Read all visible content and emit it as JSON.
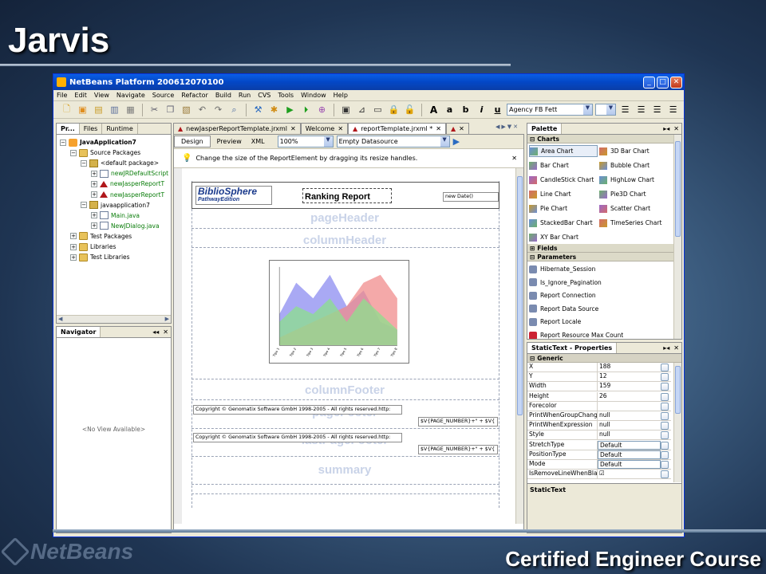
{
  "slide": {
    "title": "Jarvis",
    "footer": "Certified Engineer Course",
    "logo_text": "NetBeans"
  },
  "window": {
    "title": "NetBeans Platform 200612070100",
    "controls": [
      "_",
      "□",
      "✕"
    ]
  },
  "menu": [
    "File",
    "Edit",
    "View",
    "Navigate",
    "Source",
    "Refactor",
    "Build",
    "Run",
    "CVS",
    "Tools",
    "Window",
    "Help"
  ],
  "toolbar": {
    "font_name": "Agency FB Fett",
    "format_buttons": [
      "A",
      "a",
      "b",
      "i",
      "u"
    ]
  },
  "left_panel": {
    "tabs": [
      "Pr...",
      "Files",
      "Runtime"
    ],
    "tree": [
      {
        "label": "JavaApplication7",
        "depth": 0,
        "icon": "proj",
        "color": "black",
        "bold": true
      },
      {
        "label": "Source Packages",
        "depth": 1,
        "icon": "folder",
        "color": "black"
      },
      {
        "label": "<default package>",
        "depth": 2,
        "icon": "pkg",
        "color": "black"
      },
      {
        "label": "newJRDefaultScript",
        "depth": 3,
        "icon": "java",
        "color": "green"
      },
      {
        "label": "newJasperReportT",
        "depth": 3,
        "icon": "jr",
        "color": "green"
      },
      {
        "label": "newJasperReportT",
        "depth": 3,
        "icon": "jr",
        "color": "green"
      },
      {
        "label": "javaapplication7",
        "depth": 2,
        "icon": "pkg",
        "color": "black"
      },
      {
        "label": "Main.java",
        "depth": 3,
        "icon": "java",
        "color": "green"
      },
      {
        "label": "NewJDialog.java",
        "depth": 3,
        "icon": "java",
        "color": "green"
      },
      {
        "label": "Test Packages",
        "depth": 1,
        "icon": "folder",
        "color": "black"
      },
      {
        "label": "Libraries",
        "depth": 1,
        "icon": "folder",
        "color": "black"
      },
      {
        "label": "Test Libraries",
        "depth": 1,
        "icon": "folder",
        "color": "black"
      }
    ]
  },
  "navigator": {
    "title": "Navigator",
    "empty_text": "<No View Available>"
  },
  "editor": {
    "tabs": [
      "newJasperReportTemplate.jrxml",
      "Welcome",
      "reportTemplate.jrxml *",
      "▲"
    ],
    "view_tabs": [
      "Design",
      "Preview",
      "XML"
    ],
    "zoom": "100%",
    "datasource": "Empty Datasource",
    "hint": "Change the size of the ReportElement by dragging its resize handles.",
    "report": {
      "logo_main": "BiblioSphere",
      "logo_sub": "PathwayEdition",
      "title": "Ranking Report",
      "date_expr": "new Date()",
      "bands": [
        "pageHeader",
        "columnHeader",
        "columnFooter",
        "pageFooter",
        "lastPageFooter",
        "summary"
      ],
      "copyright": "Copyright © Genomatix Software GmbH 1998-2005 - All rights reserved.http:",
      "page_expr": "$V{PAGE_NUMBER}+\" + $V{"
    }
  },
  "palette": {
    "title": "Palette",
    "categories": [
      "Charts",
      "Fields",
      "Parameters"
    ],
    "charts": [
      "Area Chart",
      "3D Bar Chart",
      "Bar Chart",
      "Bubble Chart",
      "CandleStick Chart",
      "HighLow Chart",
      "Line Chart",
      "Pie3D Chart",
      "Pie Chart",
      "Scatter Chart",
      "StackedBar Chart",
      "TimeSeries Chart",
      "XY Bar Chart"
    ],
    "parameters": [
      "Hibernate_Session",
      "Is_Ignore_Pagination",
      "Report Connection",
      "Report Data Source",
      "Report Locale",
      "Report Resource Max Count"
    ]
  },
  "properties": {
    "title": "StaticText - Properties",
    "group": "Generic",
    "rows": [
      {
        "k": "X",
        "v": "188"
      },
      {
        "k": "Y",
        "v": "12"
      },
      {
        "k": "Width",
        "v": "159"
      },
      {
        "k": "Height",
        "v": "26"
      },
      {
        "k": "Forecolor",
        "v": ""
      },
      {
        "k": "PrintWhenGroupChanges",
        "v": "null"
      },
      {
        "k": "PrintWhenExpression",
        "v": "null"
      },
      {
        "k": "Style",
        "v": "null"
      },
      {
        "k": "StretchType",
        "v": "Default"
      },
      {
        "k": "PositionType",
        "v": "Default"
      },
      {
        "k": "Mode",
        "v": "Default"
      },
      {
        "k": "IsRemoveLineWhenBlank",
        "v": "☑"
      }
    ],
    "footer": "StaticText"
  },
  "chart_data": {
    "type": "area",
    "categories": [
      "Tipo 1",
      "Tipo 2",
      "Tipo 3",
      "Tipo 4",
      "Tipo 5",
      "Tipo 6",
      "Tipo 7",
      "Tipo 8"
    ],
    "series": [
      {
        "values": [
          4,
          8,
          6,
          9,
          5,
          7,
          3,
          2
        ],
        "color": "#8c8cf0"
      },
      {
        "values": [
          1,
          2,
          3,
          4,
          5,
          8,
          9,
          6
        ],
        "color": "#f08c8c"
      },
      {
        "values": [
          3,
          5,
          4,
          6,
          3,
          6,
          4,
          2
        ],
        "color": "#8ce08c"
      }
    ],
    "ylim": [
      0,
      10
    ]
  }
}
